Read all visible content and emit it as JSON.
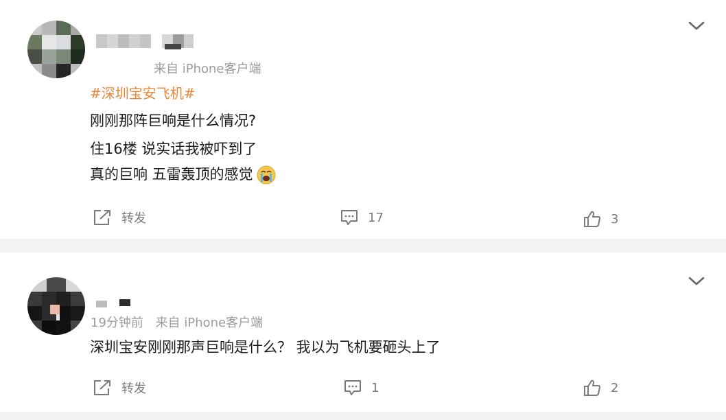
{
  "posts": [
    {
      "time": "",
      "source": "来自 iPhone客户端",
      "hashtag": "#深圳宝安飞机#",
      "lines": [
        "刚刚那阵巨响是什么情况?",
        "住16楼 说实话我被吓到了",
        "真的巨响 五雷轰顶的感觉"
      ],
      "emoji": "crying-emoji",
      "actions": {
        "repost_label": "转发",
        "comment_count": "17",
        "like_count": "3"
      }
    },
    {
      "time": "19分钟前",
      "source": "来自 iPhone客户端",
      "lines": [
        "深圳宝安刚刚那声巨响是什么？ 我以为飞机要砸头上了"
      ],
      "actions": {
        "repost_label": "转发",
        "comment_count": "1",
        "like_count": "2"
      }
    }
  ],
  "colors": {
    "hashtag": "#e8873a",
    "meta": "#9b9b9b",
    "action": "#7a7a7a",
    "background": "#f2f2f2"
  },
  "icons": [
    "chevron-down-icon",
    "repost-icon",
    "comment-icon",
    "like-icon"
  ]
}
